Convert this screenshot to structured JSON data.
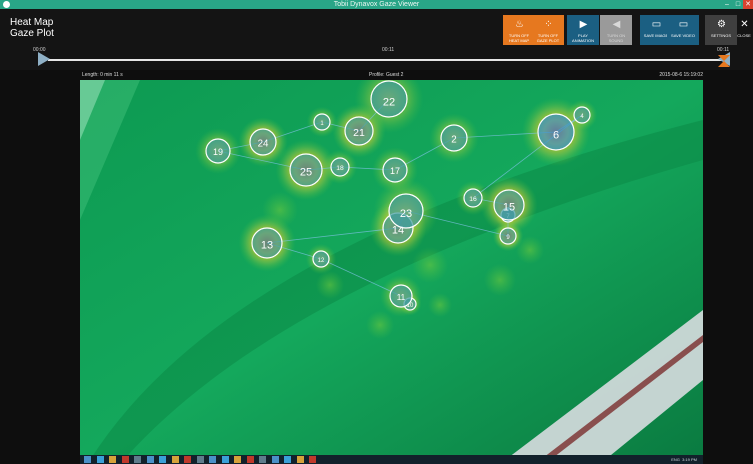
{
  "window": {
    "title": "Tobii Dynavox Gaze Viewer",
    "minimize": "–",
    "maximize": "□",
    "close": "✕"
  },
  "modes": [
    "Heat Map",
    "Gaze Plot"
  ],
  "toolbar": [
    {
      "label": "TURN OFF\nHEAT MAP",
      "icon": "heatmap-icon",
      "glyph": "♨",
      "style": "orange"
    },
    {
      "label": "TURN OFF\nGAZE PLOT",
      "icon": "gazeplot-icon",
      "glyph": "⁘",
      "style": "orange"
    },
    {
      "label": "PLAY\nANIMATION",
      "icon": "play-icon",
      "glyph": "▶",
      "style": "blue"
    },
    {
      "label": "TURN ON\nSOUND",
      "icon": "sound-icon",
      "glyph": "◀",
      "style": "grey"
    },
    {
      "label": "SAVE IMAGE",
      "icon": "save-image-icon",
      "glyph": "▭",
      "style": "blue"
    },
    {
      "label": "SAVE VIDEO",
      "icon": "save-video-icon",
      "glyph": "▭",
      "style": "blue"
    },
    {
      "label": "SETTINGS",
      "icon": "gear-icon",
      "glyph": "⚙",
      "style": "dark"
    },
    {
      "label": "CLOSE",
      "icon": "close-icon",
      "glyph": "✕",
      "style": "plain"
    }
  ],
  "timeline": {
    "start": "00:00",
    "mid": "00:11",
    "end": "00:11",
    "progress": 1.0
  },
  "info": {
    "length": "Length: 0 min 11 s",
    "profile": "Profile: Guest 2",
    "date": "2015-08-6 15:19:02"
  },
  "fixations": [
    {
      "n": "1"
    },
    {
      "n": "2"
    },
    {
      "n": "4"
    },
    {
      "n": "6"
    },
    {
      "n": "7"
    },
    {
      "n": "9"
    },
    {
      "n": "10"
    },
    {
      "n": "11"
    },
    {
      "n": "12"
    },
    {
      "n": "13"
    },
    {
      "n": "14"
    },
    {
      "n": "15"
    },
    {
      "n": "16"
    },
    {
      "n": "17"
    },
    {
      "n": "18"
    },
    {
      "n": "19"
    },
    {
      "n": "21"
    },
    {
      "n": "22"
    },
    {
      "n": "23"
    },
    {
      "n": "24"
    },
    {
      "n": "25"
    }
  ],
  "taskbar": {
    "lang": "ENG",
    "time": "3:19 PM"
  }
}
